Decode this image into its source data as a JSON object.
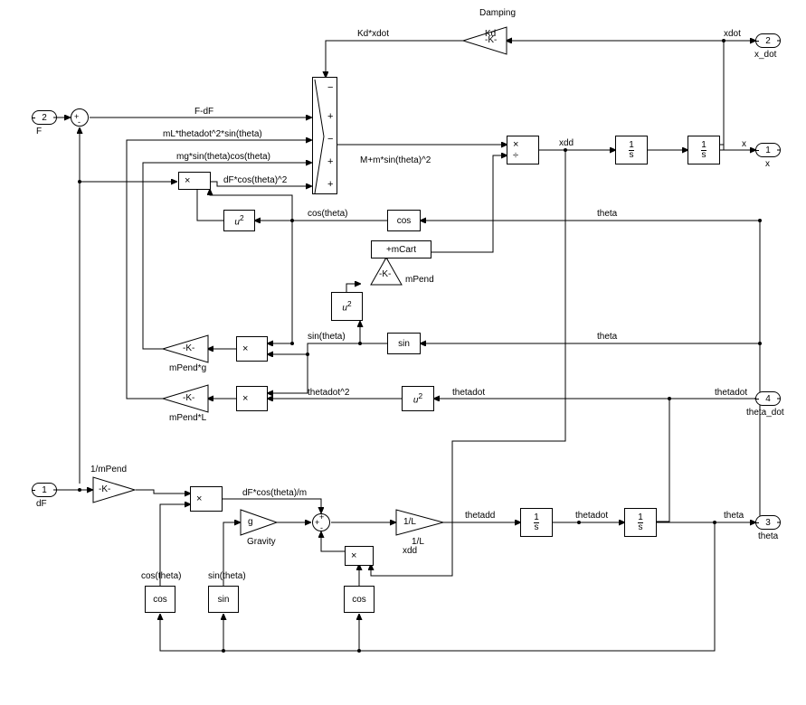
{
  "ports": {
    "in_F": {
      "num": "2",
      "label": "F"
    },
    "in_dF": {
      "num": "1",
      "label": "dF"
    },
    "out_xdot": {
      "num": "2",
      "label": "x_dot"
    },
    "out_x": {
      "num": "1",
      "label": "x"
    },
    "out_theta": {
      "num": "3",
      "label": "theta"
    },
    "out_thetadot": {
      "num": "4",
      "label": "theta_dot"
    }
  },
  "labels": {
    "damping_title": "Damping",
    "kd_xdot": "Kd*xdot",
    "kd": "Kd",
    "xdot": "xdot",
    "F_minus_dF": "F-dF",
    "mLthetadot2sin": "mL*thetadot^2*sin(theta)",
    "mgsincos": "mg*sin(theta)cos(theta)",
    "dFcos2": "dF*cos(theta)^2",
    "Mmsin2": "M+m*sin(theta)^2",
    "xdd": "xdd",
    "x": "x",
    "cos_theta": "cos(theta)",
    "mPend": "mPend",
    "mCart_add": "+mCart",
    "mPend_g": "mPend*g",
    "mPend_L": "mPend*L",
    "sin_theta": "sin(theta)",
    "thetadot2": "thetadot^2",
    "thetadot": "thetadot",
    "theta": "theta",
    "one_over_mPend": "1/mPend",
    "dFcos_over_m": "dF*cos(theta)/m",
    "gravity": "Gravity",
    "one_over_L": "1/L",
    "one_over_L_label": "1/L",
    "thetadd": "thetadd"
  },
  "blocks": {
    "u2": "u",
    "u2_exp": "2",
    "cos": "cos",
    "sin": "sin",
    "g": "g",
    "K": "-K-",
    "integ_top": "1",
    "integ_bot": "s",
    "mult_x": "×",
    "mult_div": "÷",
    "mult_dot": "×"
  },
  "sum_signs": {
    "big": [
      "−",
      "+",
      "−",
      "+",
      "+"
    ],
    "small_top": {
      "left": "+",
      "bottom": "-"
    },
    "theta": {
      "top": "+",
      "left": "+",
      "bottom": "-"
    }
  }
}
